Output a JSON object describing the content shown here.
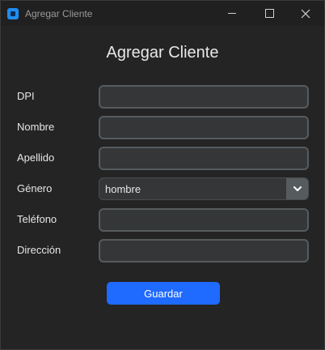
{
  "window": {
    "title": "Agregar Cliente",
    "controls": {
      "minimize": "minimize",
      "maximize": "maximize",
      "close": "close"
    }
  },
  "form": {
    "heading": "Agregar Cliente",
    "fields": [
      {
        "label": "DPI",
        "value": ""
      },
      {
        "label": "Nombre",
        "value": ""
      },
      {
        "label": "Apellido",
        "value": ""
      },
      {
        "label": "Género",
        "value": "hombre"
      },
      {
        "label": "Teléfono",
        "value": ""
      },
      {
        "label": "Dirección",
        "value": ""
      }
    ],
    "save_label": "Guardar"
  },
  "colors": {
    "background": "#242424",
    "field_bg": "#343638",
    "field_border": "#565b5e",
    "accent": "#1f6aff"
  }
}
